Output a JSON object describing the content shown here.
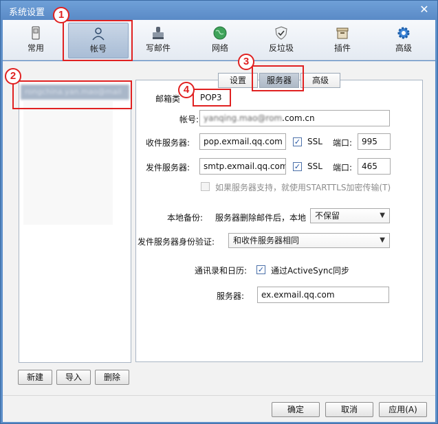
{
  "window": {
    "title": "系统设置"
  },
  "toolbar": {
    "items": [
      {
        "label": "常用",
        "icon": "phone-icon"
      },
      {
        "label": "帐号",
        "icon": "user-icon"
      },
      {
        "label": "写邮件",
        "icon": "stamp-icon"
      },
      {
        "label": "网络",
        "icon": "globe-icon"
      },
      {
        "label": "反垃圾",
        "icon": "shield-icon"
      },
      {
        "label": "插件",
        "icon": "box-icon"
      },
      {
        "label": "高级",
        "icon": "gear-icon"
      }
    ]
  },
  "badges": [
    "1",
    "2",
    "3",
    "4"
  ],
  "accounts": {
    "items": [
      {
        "label": "rongchina.yan.mao@mail"
      }
    ]
  },
  "account_buttons": {
    "new": "新建",
    "import": "导入",
    "delete": "删除"
  },
  "tabs": [
    {
      "label": "设置"
    },
    {
      "label": "服务器"
    },
    {
      "label": "高级"
    }
  ],
  "form": {
    "mailbox_type_label": "邮箱类",
    "mailbox_type_value": "POP3",
    "account_label": "帐号:",
    "account_value_hidden": "yanqing.mao@rom",
    "account_value_visible": ".com.cn",
    "incoming_label": "收件服务器:",
    "incoming_value": "pop.exmail.qq.com",
    "incoming_ssl": "SSL",
    "incoming_port_label": "端口:",
    "incoming_port": "995",
    "outgoing_label": "发件服务器:",
    "outgoing_value": "smtp.exmail.qq.com",
    "outgoing_ssl": "SSL",
    "outgoing_port_label": "端口:",
    "outgoing_port": "465",
    "starttls_label": "如果服务器支持，就使用STARTTLS加密传输(T)",
    "backup_label": "本地备份:",
    "backup_desc": "服务器删除邮件后，本地",
    "backup_option": "不保留",
    "auth_label": "发件服务器身份验证:",
    "auth_option": "和收件服务器相同",
    "contacts_label": "通讯录和日历:",
    "activesync_label": "通过ActiveSync同步",
    "server_label": "服务器:",
    "server_value": "ex.exmail.qq.com"
  },
  "footer": {
    "ok": "确定",
    "cancel": "取消",
    "apply": "应用(A)"
  }
}
